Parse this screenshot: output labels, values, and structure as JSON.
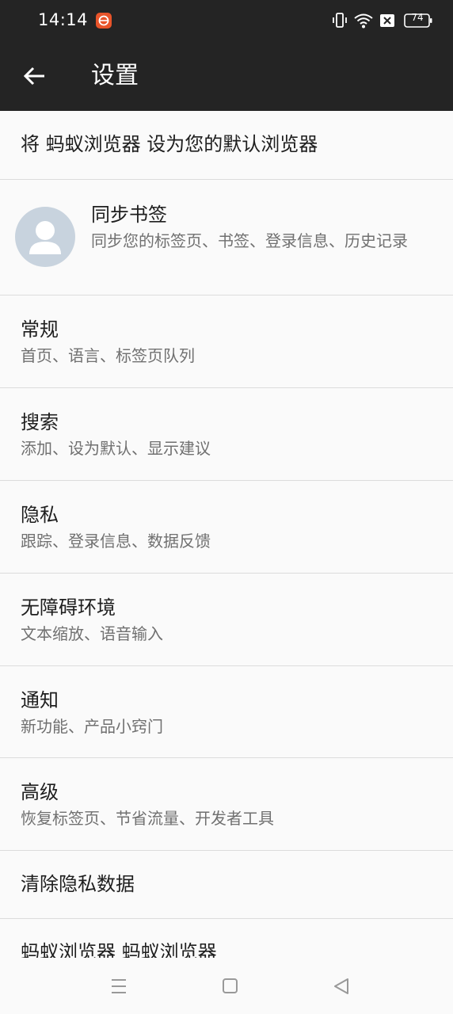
{
  "status_bar": {
    "time": "14:14",
    "battery": "74",
    "icons": [
      "app-badge-icon",
      "vibrate-icon",
      "wifi-icon",
      "no-sim-icon",
      "battery-icon"
    ]
  },
  "app_bar": {
    "title": "设置",
    "back_icon": "arrow-left-icon"
  },
  "settings": {
    "default_browser": "将 蚂蚁浏览器 设为您的默认浏览器",
    "sync": {
      "title": "同步书签",
      "subtitle": "同步您的标签页、书签、登录信息、历史记录"
    },
    "items": [
      {
        "title": "常规",
        "subtitle": "首页、语言、标签页队列"
      },
      {
        "title": "搜索",
        "subtitle": "添加、设为默认、显示建议"
      },
      {
        "title": "隐私",
        "subtitle": "跟踪、登录信息、数据反馈"
      },
      {
        "title": "无障碍环境",
        "subtitle": "文本缩放、语音输入"
      },
      {
        "title": "通知",
        "subtitle": "新功能、产品小窍门"
      },
      {
        "title": "高级",
        "subtitle": "恢复标签页、节省流量、开发者工具"
      }
    ],
    "clear_data": "清除隐私数据",
    "about": "蚂蚁浏览器 蚂蚁浏览器"
  },
  "nav_bar": {
    "icons": [
      "menu-icon",
      "home-icon",
      "back-triangle-icon"
    ]
  },
  "colors": {
    "bar_background": "#242424",
    "page_background": "#fafafa",
    "divider": "#dcdcdc",
    "avatar": "#c8d3de"
  }
}
